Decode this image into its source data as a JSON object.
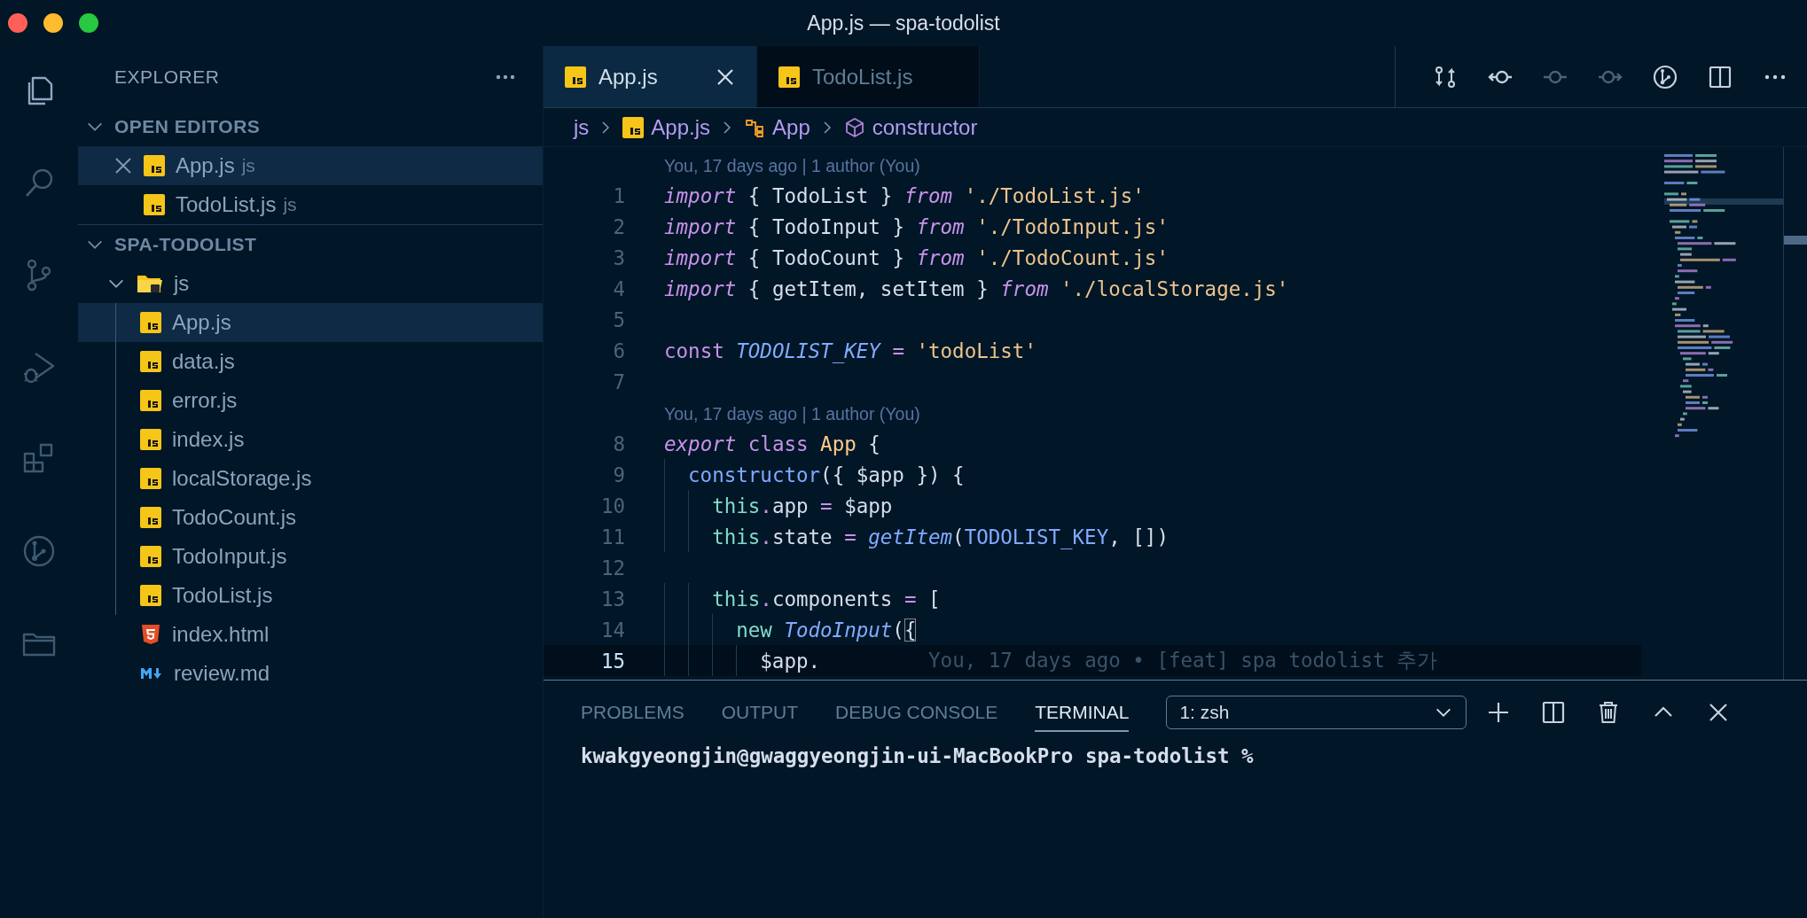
{
  "window": {
    "title": "App.js — spa-todolist"
  },
  "activity_bar": [
    {
      "kind": "files",
      "selected": true
    },
    {
      "kind": "search",
      "selected": false
    },
    {
      "kind": "source-control",
      "selected": false
    },
    {
      "kind": "run-debug",
      "selected": false
    },
    {
      "kind": "extensions",
      "selected": false
    },
    {
      "kind": "git-graph",
      "selected": false
    },
    {
      "kind": "folders",
      "selected": false
    }
  ],
  "sidebar": {
    "title": "EXPLORER",
    "sections": [
      {
        "title": "OPEN EDITORS",
        "expanded": true,
        "items": [
          {
            "label": "App.js",
            "description": "js",
            "kind": "js",
            "selected": true
          },
          {
            "label": "TodoList.js",
            "description": "js",
            "kind": "js",
            "selected": false
          }
        ]
      },
      {
        "title": "SPA-TODOLIST",
        "expanded": true,
        "items": [
          {
            "label": "js",
            "kind": "folder-js",
            "selected": false,
            "expanded": true,
            "children": [
              {
                "label": "App.js",
                "kind": "js",
                "selected": true
              },
              {
                "label": "data.js",
                "kind": "js",
                "selected": false
              },
              {
                "label": "error.js",
                "kind": "js",
                "selected": false
              },
              {
                "label": "index.js",
                "kind": "js",
                "selected": false
              },
              {
                "label": "localStorage.js",
                "kind": "js",
                "selected": false
              },
              {
                "label": "TodoCount.js",
                "kind": "js",
                "selected": false
              },
              {
                "label": "TodoInput.js",
                "kind": "js",
                "selected": false
              },
              {
                "label": "TodoList.js",
                "kind": "js",
                "selected": false
              }
            ]
          },
          {
            "label": "index.html",
            "kind": "html",
            "selected": false
          },
          {
            "label": "review.md",
            "kind": "markdown",
            "selected": false
          }
        ]
      }
    ]
  },
  "tabs": [
    {
      "label": "App.js",
      "kind": "js",
      "selected": true
    },
    {
      "label": "TodoList.js",
      "kind": "js",
      "selected": false
    }
  ],
  "editor_actions": [
    {
      "kind": "compare",
      "disabled": false
    },
    {
      "kind": "previous-revision",
      "disabled": false
    },
    {
      "kind": "commit",
      "disabled": true
    },
    {
      "kind": "next-revision",
      "disabled": true
    },
    {
      "kind": "git-graph",
      "disabled": false
    },
    {
      "kind": "split",
      "disabled": false
    },
    {
      "kind": "more",
      "disabled": false
    }
  ],
  "breadcrumb": [
    {
      "label": "js",
      "kind": "folder"
    },
    {
      "label": "App.js",
      "kind": "js"
    },
    {
      "label": "App",
      "kind": "class"
    },
    {
      "label": "constructor",
      "kind": "method"
    }
  ],
  "code": [
    {
      "kind": "codelens",
      "text": "You, 17 days ago | 1 author (You)"
    },
    {
      "kind": "line",
      "number": "1",
      "current": false,
      "tokens": [
        {
          "text": "import",
          "kind": "keyword-italic"
        },
        {
          "text": " { TodoList } ",
          "kind": "plain"
        },
        {
          "text": "from",
          "kind": "keyword-italic"
        },
        {
          "text": " './TodoList.js'",
          "kind": "string"
        }
      ]
    },
    {
      "kind": "line",
      "number": "2",
      "current": false,
      "tokens": [
        {
          "text": "import",
          "kind": "keyword-italic"
        },
        {
          "text": " { TodoInput } ",
          "kind": "plain"
        },
        {
          "text": "from",
          "kind": "keyword-italic"
        },
        {
          "text": " './TodoInput.js'",
          "kind": "string"
        }
      ]
    },
    {
      "kind": "line",
      "number": "3",
      "current": false,
      "tokens": [
        {
          "text": "import",
          "kind": "keyword-italic"
        },
        {
          "text": " { TodoCount } ",
          "kind": "plain"
        },
        {
          "text": "from",
          "kind": "keyword-italic"
        },
        {
          "text": " './TodoCount.js'",
          "kind": "string"
        }
      ]
    },
    {
      "kind": "line",
      "number": "4",
      "current": false,
      "tokens": [
        {
          "text": "import",
          "kind": "keyword-italic"
        },
        {
          "text": " { getItem, setItem } ",
          "kind": "plain"
        },
        {
          "text": "from",
          "kind": "keyword-italic"
        },
        {
          "text": " './localStorage.js'",
          "kind": "string"
        }
      ]
    },
    {
      "kind": "line",
      "number": "5",
      "current": false
    },
    {
      "kind": "line",
      "number": "6",
      "current": false,
      "tokens": [
        {
          "text": "const",
          "kind": "keyword"
        },
        {
          "text": " TODOLIST_KEY",
          "kind": "constant-italic"
        },
        {
          "text": " =",
          "kind": "operator"
        },
        {
          "text": " 'todoList'",
          "kind": "string"
        }
      ]
    },
    {
      "kind": "line",
      "number": "7",
      "current": false
    },
    {
      "kind": "codelens",
      "text": "You, 17 days ago | 1 author (You)"
    },
    {
      "kind": "line",
      "number": "8",
      "current": false,
      "tokens": [
        {
          "text": "export",
          "kind": "keyword-italic"
        },
        {
          "text": " class",
          "kind": "keyword"
        },
        {
          "text": " App",
          "kind": "class-name"
        },
        {
          "text": " {",
          "kind": "plain"
        }
      ]
    },
    {
      "kind": "line",
      "number": "9",
      "current": false,
      "tokens": [
        {
          "text": "  constructor",
          "kind": "function"
        },
        {
          "text": "({ $app }) {",
          "kind": "plain"
        }
      ]
    },
    {
      "kind": "line",
      "number": "10",
      "current": false,
      "tokens": [
        {
          "text": "    this",
          "kind": "storage"
        },
        {
          "text": ".",
          "kind": "operator"
        },
        {
          "text": "app ",
          "kind": "plain"
        },
        {
          "text": "=",
          "kind": "operator"
        },
        {
          "text": " $app",
          "kind": "plain"
        }
      ]
    },
    {
      "kind": "line",
      "number": "11",
      "current": false,
      "tokens": [
        {
          "text": "    this",
          "kind": "storage"
        },
        {
          "text": ".",
          "kind": "operator"
        },
        {
          "text": "state ",
          "kind": "plain"
        },
        {
          "text": "=",
          "kind": "operator"
        },
        {
          "text": " getItem",
          "kind": "function-italic"
        },
        {
          "text": "(",
          "kind": "plain"
        },
        {
          "text": "TODOLIST_KEY",
          "kind": "constant"
        },
        {
          "text": ", [])",
          "kind": "plain"
        }
      ]
    },
    {
      "kind": "line",
      "number": "12",
      "current": false
    },
    {
      "kind": "line",
      "number": "13",
      "current": false,
      "tokens": [
        {
          "text": "    this",
          "kind": "storage"
        },
        {
          "text": ".",
          "kind": "operator"
        },
        {
          "text": "components ",
          "kind": "plain"
        },
        {
          "text": "=",
          "kind": "operator"
        },
        {
          "text": " [",
          "kind": "plain"
        }
      ]
    },
    {
      "kind": "line",
      "number": "14",
      "current": false,
      "tokens": [
        {
          "text": "      new",
          "kind": "storage"
        },
        {
          "text": " TodoInput",
          "kind": "function-italic"
        },
        {
          "text": "(",
          "kind": "plain"
        },
        {
          "text": "{",
          "kind": "bracket-match"
        }
      ]
    },
    {
      "kind": "line",
      "number": "15",
      "current": true,
      "tokens": [
        {
          "text": "        $app.",
          "kind": "plain"
        },
        {
          "text": "You, 17 days ago • [feat] spa todolist 추가",
          "kind": "blame"
        }
      ]
    }
  ],
  "panel": {
    "tabs": [
      {
        "label": "PROBLEMS",
        "selected": false
      },
      {
        "label": "OUTPUT",
        "selected": false
      },
      {
        "label": "DEBUG CONSOLE",
        "selected": false
      },
      {
        "label": "TERMINAL",
        "selected": true
      }
    ],
    "terminal_select": {
      "value": "1: zsh"
    },
    "actions": [
      {
        "kind": "new-terminal"
      },
      {
        "kind": "split"
      },
      {
        "kind": "trash"
      },
      {
        "kind": "maximize"
      },
      {
        "kind": "close"
      }
    ],
    "terminal": {
      "lines": [
        "kwakgyeongjin@gwaggyeongjin-ui-MacBookPro spa-todolist %"
      ]
    }
  }
}
